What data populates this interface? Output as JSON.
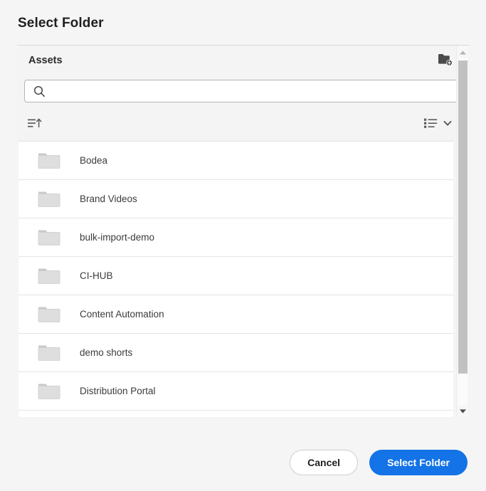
{
  "dialog": {
    "title": "Select Folder"
  },
  "panel": {
    "header_title": "Assets",
    "new_folder_icon": "new-folder-icon"
  },
  "search": {
    "value": "",
    "placeholder": "",
    "icon": "search-icon"
  },
  "toolbar": {
    "sort_icon": "sort-ascending-icon",
    "view_icon": "list-view-icon",
    "view_chevron_icon": "chevron-down-icon"
  },
  "folders": [
    {
      "name": "Bodea",
      "icon": "folder-icon"
    },
    {
      "name": "Brand Videos",
      "icon": "folder-icon"
    },
    {
      "name": "bulk-import-demo",
      "icon": "folder-icon"
    },
    {
      "name": "CI-HUB",
      "icon": "folder-icon"
    },
    {
      "name": "Content Automation",
      "icon": "folder-icon"
    },
    {
      "name": "demo shorts",
      "icon": "folder-icon"
    },
    {
      "name": "Distribution Portal",
      "icon": "folder-icon"
    }
  ],
  "scrollbar": {
    "up_icon": "scroll-up-arrow-icon",
    "down_icon": "scroll-down-arrow-icon"
  },
  "footer": {
    "cancel_label": "Cancel",
    "confirm_label": "Select Folder"
  },
  "colors": {
    "accent": "#1473e6",
    "panel_bg": "#f4f4f4",
    "page_bg": "#f5f5f5",
    "list_bg": "#ffffff",
    "folder_icon": "#dcdcdc",
    "text": "#2b2b2b"
  }
}
